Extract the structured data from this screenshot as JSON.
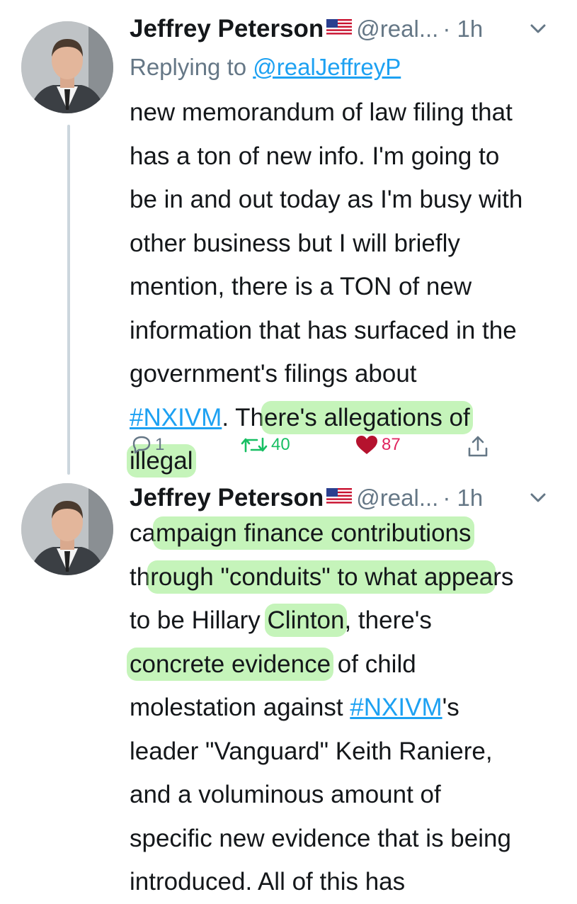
{
  "tweets": [
    {
      "author": "Jeffrey Peterson",
      "handle": "@real...",
      "time": "· 1h",
      "replying_prefix": "Replying to ",
      "replying_handle": "@realJeffreyP",
      "lines": [
        "new memorandum of law filing that",
        "has a ton of new info. I'm going to",
        "be in and out today as I'm busy with",
        "other business but I will briefly",
        "mention, there is a TON of new",
        "information that has surfaced in the",
        "government's filings about"
      ],
      "line8": {
        "tag": "#NXIVM",
        "text_a": ". Th",
        "highlight": "ere's allegations of"
      },
      "line9_highlight": "illegal",
      "reply_count": "1",
      "retweet_count": "40",
      "like_count": "87"
    },
    {
      "author": "Jeffrey Peterson",
      "handle": "@real...",
      "time": "· 1h",
      "line1": {
        "a": "ca",
        "hl": "mpaign finance contributions"
      },
      "line2": {
        "a": "th",
        "hl": "rough \"conduits\" to what appea",
        "b": "rs"
      },
      "line3": {
        "a": "to be Hillary ",
        "hl": "Clinton",
        "b": ", there's"
      },
      "line4": {
        "hl": "concrete evidence",
        "b": " of child"
      },
      "line5": {
        "a": "molestation against ",
        "tag": "#NXIVM",
        "b": "'s"
      },
      "lines_rest": [
        "leader \"Vanguard\" Keith Raniere,",
        "and a voluminous amount of",
        "specific new evidence that is being",
        "introduced. All of this has"
      ]
    }
  ],
  "icons": [
    "avatar",
    "us-flag-icon",
    "chevron-down-icon",
    "reply-icon",
    "retweet-icon",
    "heart-icon",
    "share-icon"
  ],
  "colors": {
    "link": "#1da1f2",
    "muted": "#657786",
    "retweet": "#17bf63",
    "like": "#e0245e",
    "highlight": "#96eb82"
  }
}
